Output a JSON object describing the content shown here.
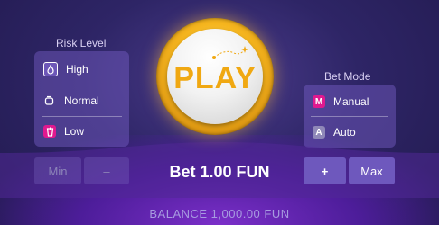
{
  "risk": {
    "title": "Risk Level",
    "items": [
      {
        "label": "High",
        "icon": "flame-icon",
        "glyph": "🔥"
      },
      {
        "label": "Normal",
        "icon": "coffee-cup-icon",
        "glyph": "☕"
      },
      {
        "label": "Low",
        "icon": "ice-drink-icon",
        "glyph": "🥤"
      }
    ]
  },
  "bet_mode": {
    "title": "Bet Mode",
    "items": [
      {
        "label": "Manual",
        "icon_letter": "M",
        "icon_color": "#e0198f"
      },
      {
        "label": "Auto",
        "icon_letter": "A",
        "icon_color": "#8f88b8"
      }
    ]
  },
  "play_button": {
    "label": "PLAY"
  },
  "bet": {
    "text": "Bet 1.00 FUN",
    "min_label": "Min",
    "minus_label": "–",
    "plus_label": "+",
    "max_label": "Max"
  },
  "balance": {
    "text": "BALANCE 1,000.00 FUN"
  },
  "colors": {
    "accent_gold": "#f0a812",
    "panel": "#6a55b8",
    "manual_badge": "#e0198f"
  }
}
